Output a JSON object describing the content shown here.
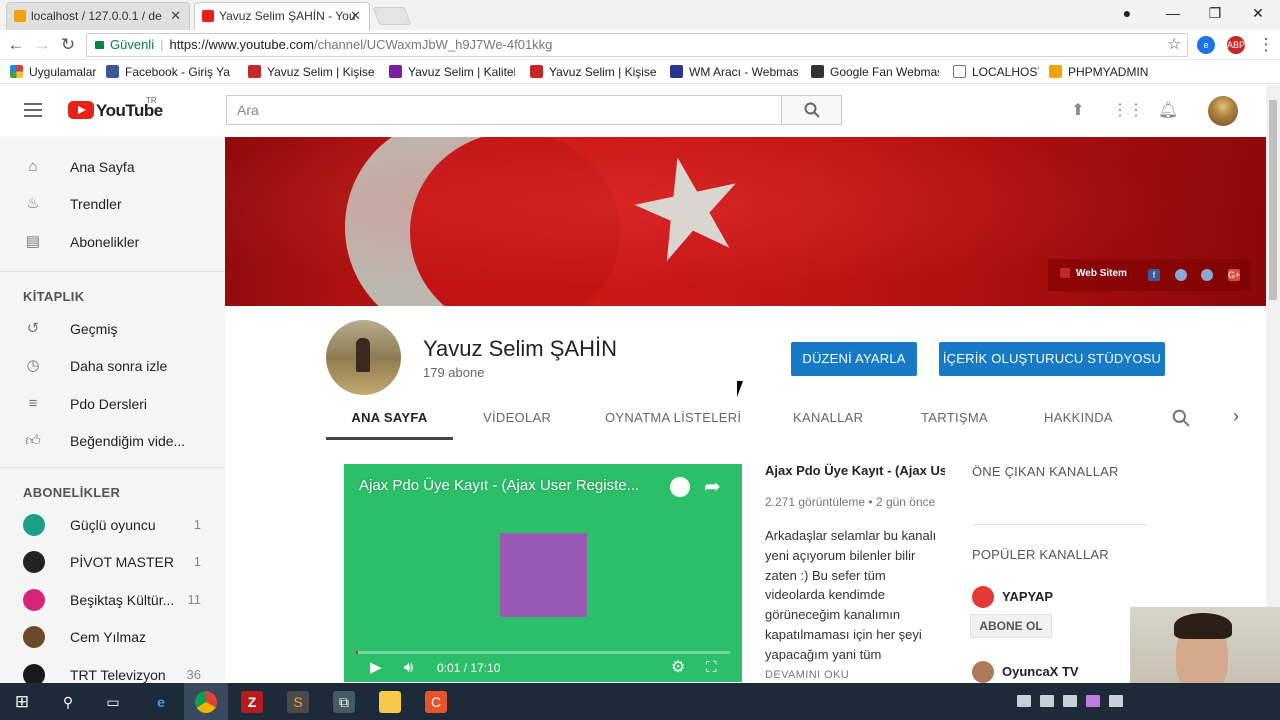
{
  "browser": {
    "tabs": [
      {
        "title": "localhost / 127.0.0.1 / de",
        "active": false
      },
      {
        "title": "Yavuz Selim ŞAHİN - You",
        "active": true
      }
    ],
    "secure_label": "Güvenli",
    "url_host": "https://www.youtube.com",
    "url_path": "/channel/UCWaxmJbW_h9J7We-4f01kkg",
    "bookmarks": [
      "Uygulamalar",
      "Facebook - Giriş Yap",
      "Yavuz Selim | Kişisel",
      "Yavuz Selim | Kaliteli",
      "Yavuz Selim | Kişisel B",
      "WM Aracı - Webmast",
      "Google Fan Webmaste",
      "LOCALHOST",
      "PHPMYADMIN"
    ]
  },
  "youtube": {
    "logo_text": "YouTube",
    "logo_region": "TR",
    "search_placeholder": "Ara"
  },
  "sidebar": {
    "main_items": [
      {
        "label": "Ana Sayfa",
        "icon": "home-icon"
      },
      {
        "label": "Trendler",
        "icon": "flame-icon"
      },
      {
        "label": "Abonelikler",
        "icon": "subscriptions-icon"
      }
    ],
    "library_heading": "KİTAPLIK",
    "library_items": [
      {
        "label": "Geçmiş",
        "icon": "history-icon"
      },
      {
        "label": "Daha sonra izle",
        "icon": "clock-icon"
      },
      {
        "label": "Pdo Dersleri",
        "icon": "playlist-icon"
      },
      {
        "label": "Beğendiğim vide...",
        "icon": "thumbs-up-icon"
      }
    ],
    "subs_heading": "ABONELİKLER",
    "subscriptions": [
      {
        "name": "Güçlü oyuncu",
        "count": "1",
        "color": "#1aa085"
      },
      {
        "name": "PİVOT MASTER",
        "count": "1",
        "color": "#222222"
      },
      {
        "name": "Beşiktaş Kültür...",
        "count": "11",
        "color": "#d6247b"
      },
      {
        "name": "Cem Yılmaz",
        "count": "",
        "color": "#6b4a2a"
      },
      {
        "name": "TRT Televizyon",
        "count": "36",
        "color": "#1a1a1a"
      }
    ]
  },
  "banner": {
    "web_label": "Web Sitem",
    "social": [
      "facebook-icon",
      "globe-icon",
      "globe-icon",
      "google-plus-icon"
    ]
  },
  "channel": {
    "name": "Yavuz Selim ŞAHİN",
    "subscribers": "179 abone",
    "customize_button": "DÜZENİ AYARLA",
    "studio_button": "İÇERİK OLUŞTURUCU STÜDYOSU",
    "tabs": [
      "ANA SAYFA",
      "VİDEOLAR",
      "OYNATMA LİSTELERİ",
      "KANALLAR",
      "TARTIŞMA",
      "HAKKINDA"
    ],
    "active_tab": "ANA SAYFA"
  },
  "video": {
    "player_title": "Ajax Pdo Üye Kayıt - (Ajax User Registe...",
    "time": "0:01 / 17:10",
    "progress": 0.001,
    "title": "Ajax Pdo Üye Kayıt - (Ajax Us...",
    "meta": "2.271 görüntüleme • 2 gün önce",
    "description": "Arkadaşlar selamlar bu kanalı yeni açıyorum bilenler bilir zaten :) Bu sefer tüm videolarda kendimde görüneceğim kanalımın kapatılmaması için her şeyi yapacağım yani tüm",
    "more": "DEVAMINI OKU"
  },
  "right_column": {
    "featured_heading": "ÖNE ÇIKAN KANALLAR",
    "popular_heading": "POPÜLER KANALLAR",
    "channels": [
      {
        "name": "YAPYAP",
        "color": "#e53935"
      },
      {
        "name": "OyuncaX TV",
        "color": "#b07a5a"
      }
    ],
    "subscribe_label": "ABONE OL"
  }
}
